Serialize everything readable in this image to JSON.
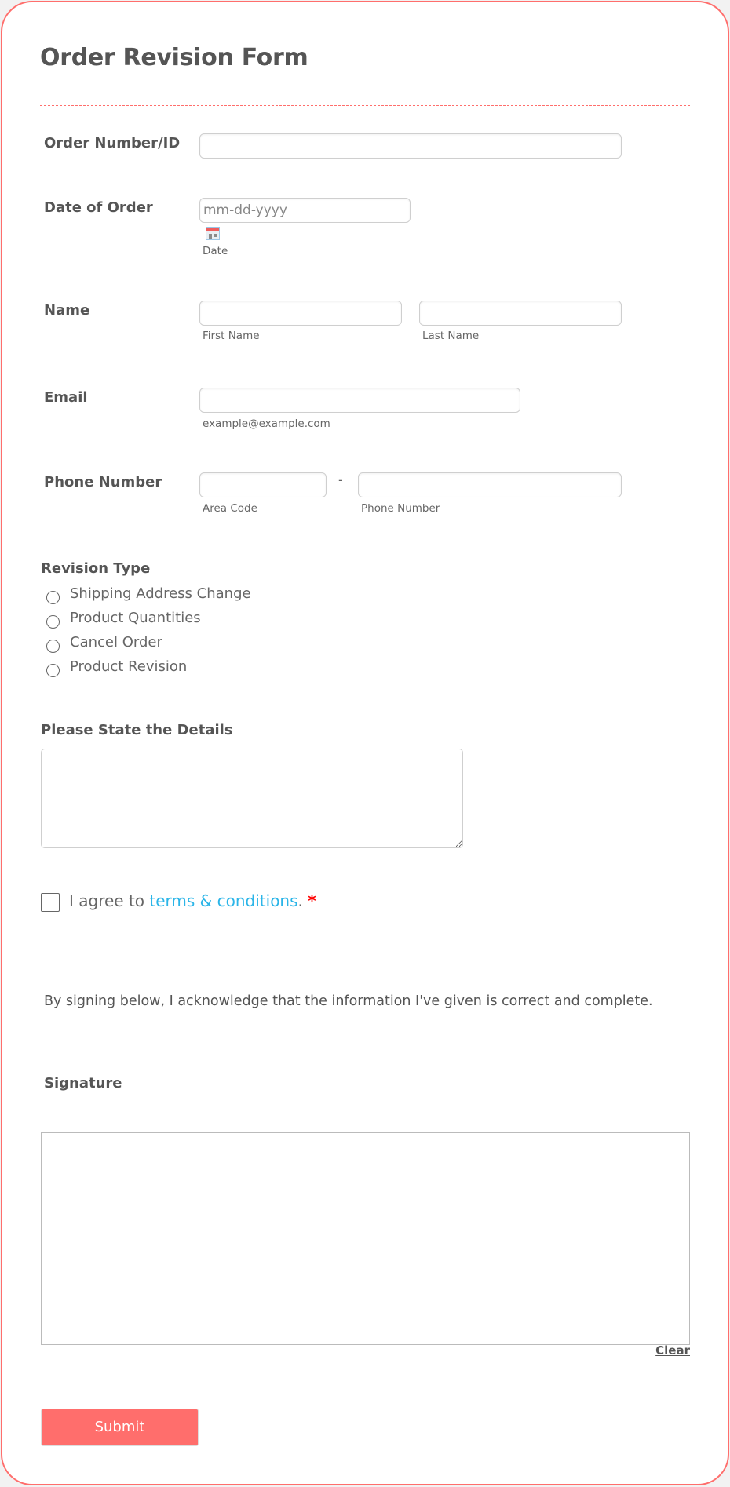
{
  "form": {
    "title": "Order Revision Form",
    "accent_color": "#ff6e6c",
    "fields": {
      "order_number": {
        "label": "Order Number/ID",
        "value": ""
      },
      "date_of_order": {
        "label": "Date of Order",
        "placeholder": "mm-dd-yyyy",
        "value": "",
        "sublabel": "Date",
        "icon": "calendar-icon"
      },
      "name": {
        "label": "Name",
        "first_sublabel": "First Name",
        "last_sublabel": "Last Name",
        "first_value": "",
        "last_value": ""
      },
      "email": {
        "label": "Email",
        "sublabel": "example@example.com",
        "value": ""
      },
      "phone": {
        "label": "Phone Number",
        "separator": "-",
        "area_sublabel": "Area Code",
        "number_sublabel": "Phone Number",
        "area_value": "",
        "number_value": ""
      },
      "revision_type": {
        "label": "Revision Type",
        "options": [
          "Shipping Address Change",
          "Product Quantities",
          "Cancel Order",
          "Product Revision"
        ],
        "selected": null
      },
      "details": {
        "label": "Please State the Details",
        "value": ""
      },
      "agree": {
        "prefix": "I agree to ",
        "link_text": "terms & conditions",
        "suffix": ".",
        "required_mark": "*",
        "checked": false
      },
      "acknowledgement": "By signing below, I acknowledge that the information I've given is correct and complete.",
      "signature": {
        "label": "Signature",
        "clear_label": "Clear"
      }
    },
    "submit_label": "Submit"
  }
}
